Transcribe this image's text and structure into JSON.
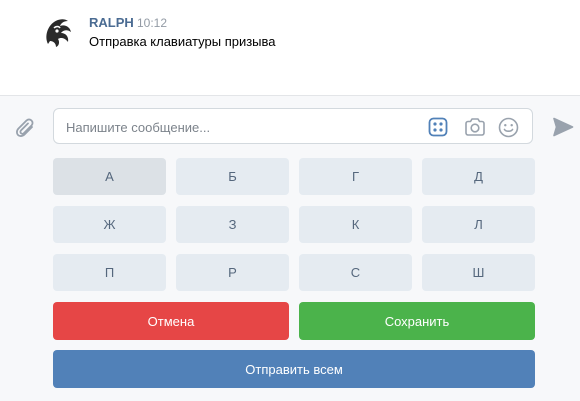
{
  "message": {
    "author": "RALPH",
    "time": "10:12",
    "text": "Отправка клавиатуры призыва"
  },
  "composer": {
    "placeholder": "Напишите сообщение..."
  },
  "keyboard": {
    "rows": [
      [
        "А",
        "Б",
        "Г",
        "Д"
      ],
      [
        "Ж",
        "З",
        "К",
        "Л"
      ],
      [
        "П",
        "Р",
        "С",
        "Ш"
      ]
    ],
    "cancel_label": "Отмена",
    "save_label": "Сохранить",
    "send_all_label": "Отправить всем"
  },
  "colors": {
    "author": "#4a6b92",
    "key_bg": "#e5ebf1",
    "key_text": "#55677d",
    "cancel": "#e64646",
    "save": "#4bb34b",
    "send_all": "#5181b8"
  },
  "icons": {
    "attach": "paperclip-icon",
    "keyboard": "bot-keyboard-icon",
    "camera": "camera-icon",
    "emoji": "smile-icon",
    "send": "send-icon"
  }
}
